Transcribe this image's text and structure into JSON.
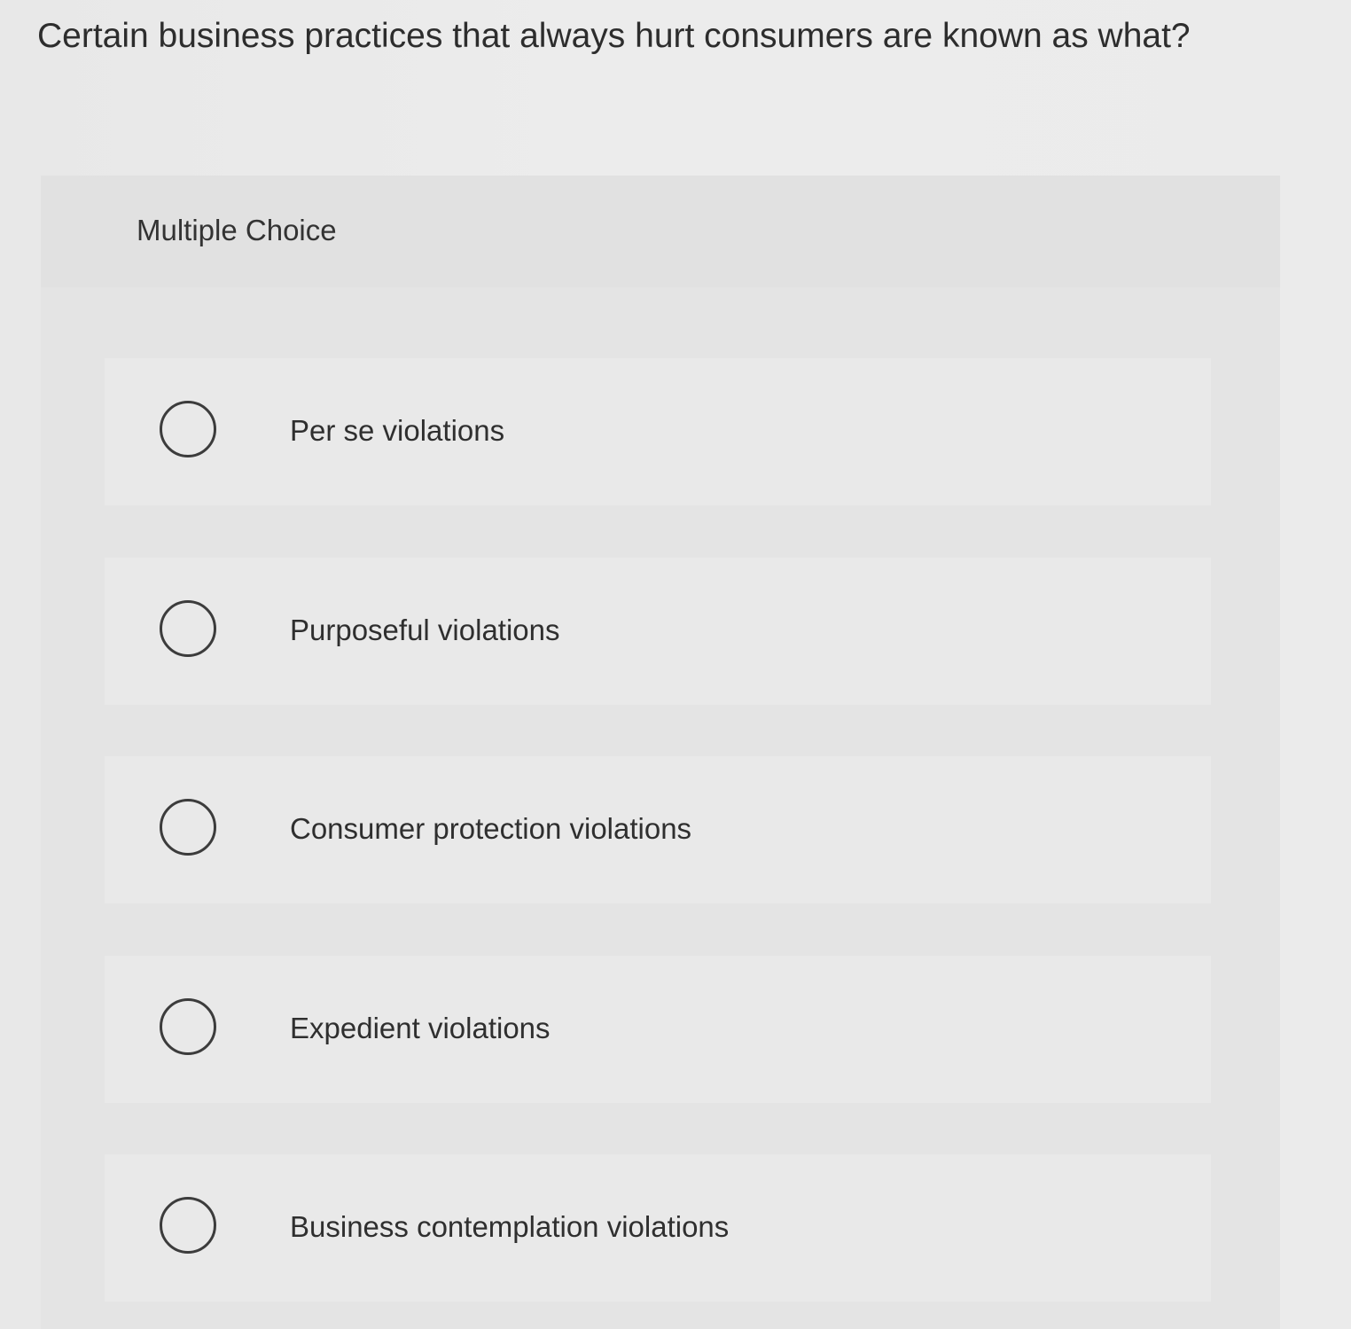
{
  "question": {
    "text": "Certain business practices that always hurt consumers are known as what?"
  },
  "panel": {
    "label": "Multiple Choice"
  },
  "options": [
    {
      "label": "Per se violations",
      "selected": false
    },
    {
      "label": "Purposeful violations",
      "selected": false
    },
    {
      "label": "Consumer protection violations",
      "selected": false
    },
    {
      "label": "Expedient violations",
      "selected": false
    },
    {
      "label": "Business contemplation violations",
      "selected": false
    }
  ],
  "colors": {
    "page_background": "#e8e8e8",
    "panel_background": "#e4e4e4",
    "option_background": "#e9e9e9",
    "text": "#2d2d2d",
    "radio_border": "#3c3c3c"
  },
  "icons": {
    "radio": "radio-button-unchecked-icon"
  }
}
